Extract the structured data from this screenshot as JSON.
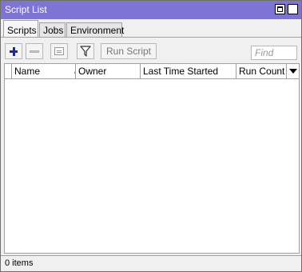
{
  "window": {
    "title": "Script List"
  },
  "tabs": [
    {
      "label": "Scripts",
      "active": true
    },
    {
      "label": "Jobs",
      "active": false
    },
    {
      "label": "Environment",
      "active": false
    }
  ],
  "toolbar": {
    "add_icon": "plus-icon",
    "remove_icon": "minus-icon",
    "comment_icon": "note-icon",
    "filter_icon": "filter-icon",
    "run_script_label": "Run Script",
    "find_placeholder": "Find"
  },
  "table": {
    "columns": [
      "Name",
      "Owner",
      "Last Time Started",
      "Run Count"
    ],
    "sort_indicator": "/",
    "rows": []
  },
  "status": {
    "text": "0 items"
  },
  "colors": {
    "titlebar": "#7d74d6",
    "add_icon": "#1f2b8a"
  }
}
